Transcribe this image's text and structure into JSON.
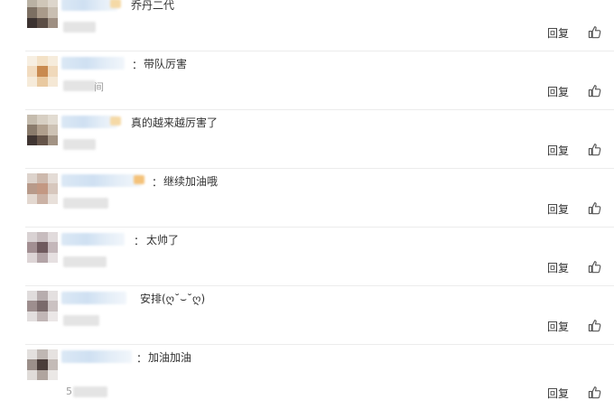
{
  "comments": [
    {
      "text": "乔丹二代",
      "reply_label": "回复",
      "time_char": ""
    },
    {
      "text": "带队厉害",
      "reply_label": "回复",
      "time_char": "间"
    },
    {
      "text": "真的越来越厉害了",
      "reply_label": "回复",
      "time_char": ""
    },
    {
      "text": "继续加油哦",
      "reply_label": "回复",
      "time_char": ""
    },
    {
      "text": "太帅了",
      "reply_label": "回复",
      "time_char": ""
    },
    {
      "text": "安排(ღ˘⌣˘ღ)",
      "reply_label": "回复",
      "time_char": ""
    },
    {
      "text": "加油加油",
      "reply_label": "回复",
      "time_char": "5"
    }
  ],
  "colon": "：",
  "colors": {
    "separator": "#ececec",
    "blurred_name": "#cfe0f2",
    "text": "#333333"
  }
}
